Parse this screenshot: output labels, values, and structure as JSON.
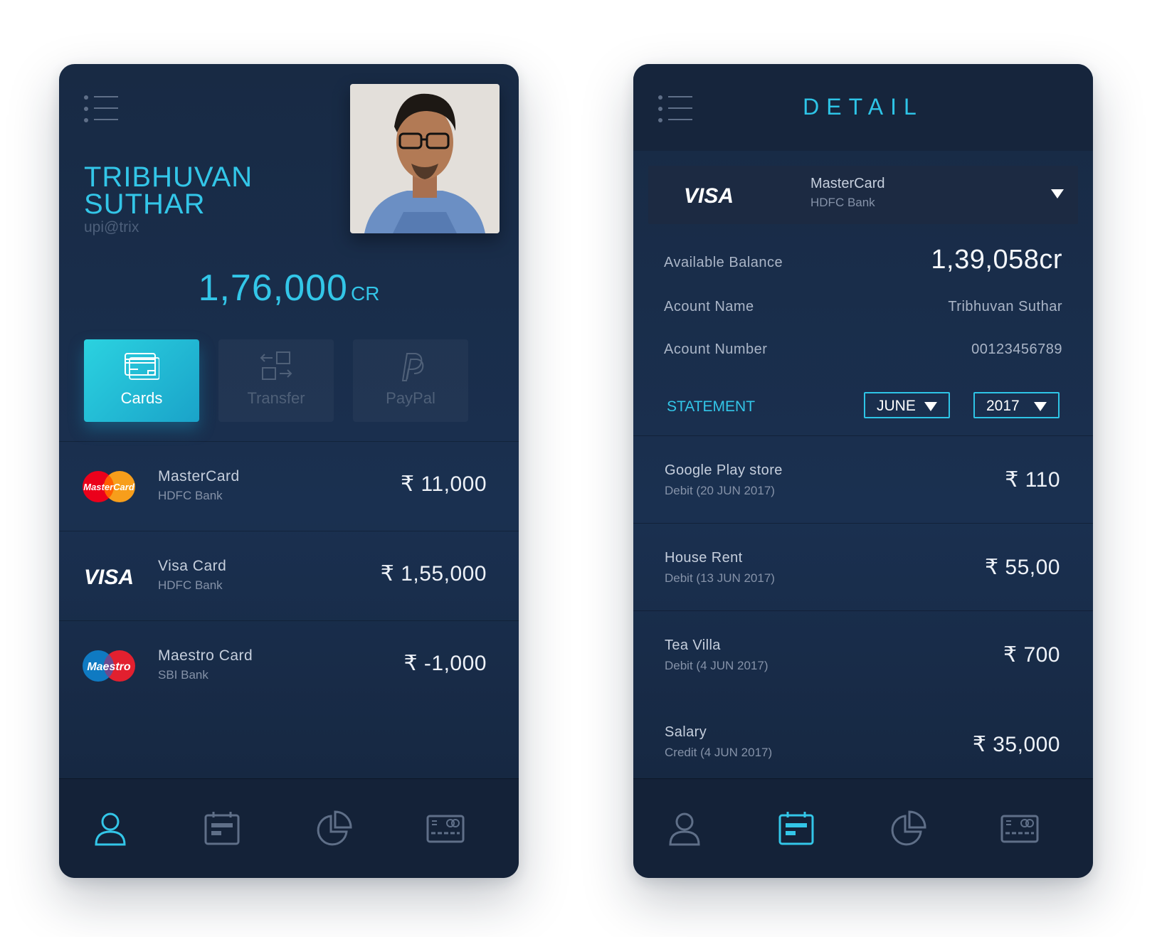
{
  "home": {
    "profile": {
      "name_line1": "TRIBHUVAN",
      "name_line2": "SUTHAR",
      "upi": "upi@trix"
    },
    "balance": {
      "amount": "1,76,000",
      "unit": "CR"
    },
    "tabs": [
      {
        "label": "Cards",
        "icon": "card-icon",
        "active": true
      },
      {
        "label": "Transfer",
        "icon": "transfer-icon",
        "active": false
      },
      {
        "label": "PayPal",
        "icon": "paypal-icon",
        "active": false
      }
    ],
    "cards": [
      {
        "name": "MasterCard",
        "bank": "HDFC Bank",
        "amount": "₹ 11,000",
        "logo": "mastercard-logo",
        "logo_text": "MasterCard"
      },
      {
        "name": "Visa Card",
        "bank": "HDFC Bank",
        "amount": "₹ 1,55,000",
        "logo": "visa-logo",
        "logo_text": "VISA"
      },
      {
        "name": "Maestro Card",
        "bank": "SBI Bank",
        "amount": "₹  -1,000",
        "logo": "maestro-logo",
        "logo_text": "Maestro"
      }
    ],
    "bottom_nav": [
      {
        "icon": "profile-icon",
        "active": true
      },
      {
        "icon": "calendar-icon",
        "active": false
      },
      {
        "icon": "pie-chart-icon",
        "active": false
      },
      {
        "icon": "card-icon",
        "active": false
      }
    ]
  },
  "detail": {
    "title": "DETAIL",
    "selected_card": {
      "logo_text": "VISA",
      "name": "MasterCard",
      "bank": "HDFC Bank"
    },
    "available_balance": {
      "label": "Available Balance",
      "value": "1,39,058cr"
    },
    "account_name": {
      "label": "Acount Name",
      "value": "Tribhuvan Suthar"
    },
    "account_number": {
      "label": "Acount Number",
      "value": "00123456789"
    },
    "statement": {
      "label": "STATEMENT",
      "month": "JUNE",
      "year": "2017"
    },
    "transactions": [
      {
        "name": "Google Play store",
        "sub": "Debit (20 JUN 2017)",
        "amount": "₹ 110"
      },
      {
        "name": "House Rent",
        "sub": "Debit (13 JUN 2017)",
        "amount": "₹ 55,00"
      },
      {
        "name": "Tea Villa",
        "sub": "Debit (4 JUN 2017)",
        "amount": "₹  700"
      },
      {
        "name": "Salary",
        "sub": "Credit (4 JUN 2017)",
        "amount": "₹ 35,000"
      }
    ],
    "bottom_nav": [
      {
        "icon": "profile-icon",
        "active": false
      },
      {
        "icon": "calendar-icon",
        "active": true
      },
      {
        "icon": "pie-chart-icon",
        "active": false
      },
      {
        "icon": "card-icon",
        "active": false
      }
    ]
  },
  "colors": {
    "accent": "#33c6e8",
    "phone_bg": "#1a3050",
    "icon_inactive": "#5f6f88",
    "tab_active_start": "#2bd2e0",
    "tab_active_end": "#1aa3c9"
  }
}
